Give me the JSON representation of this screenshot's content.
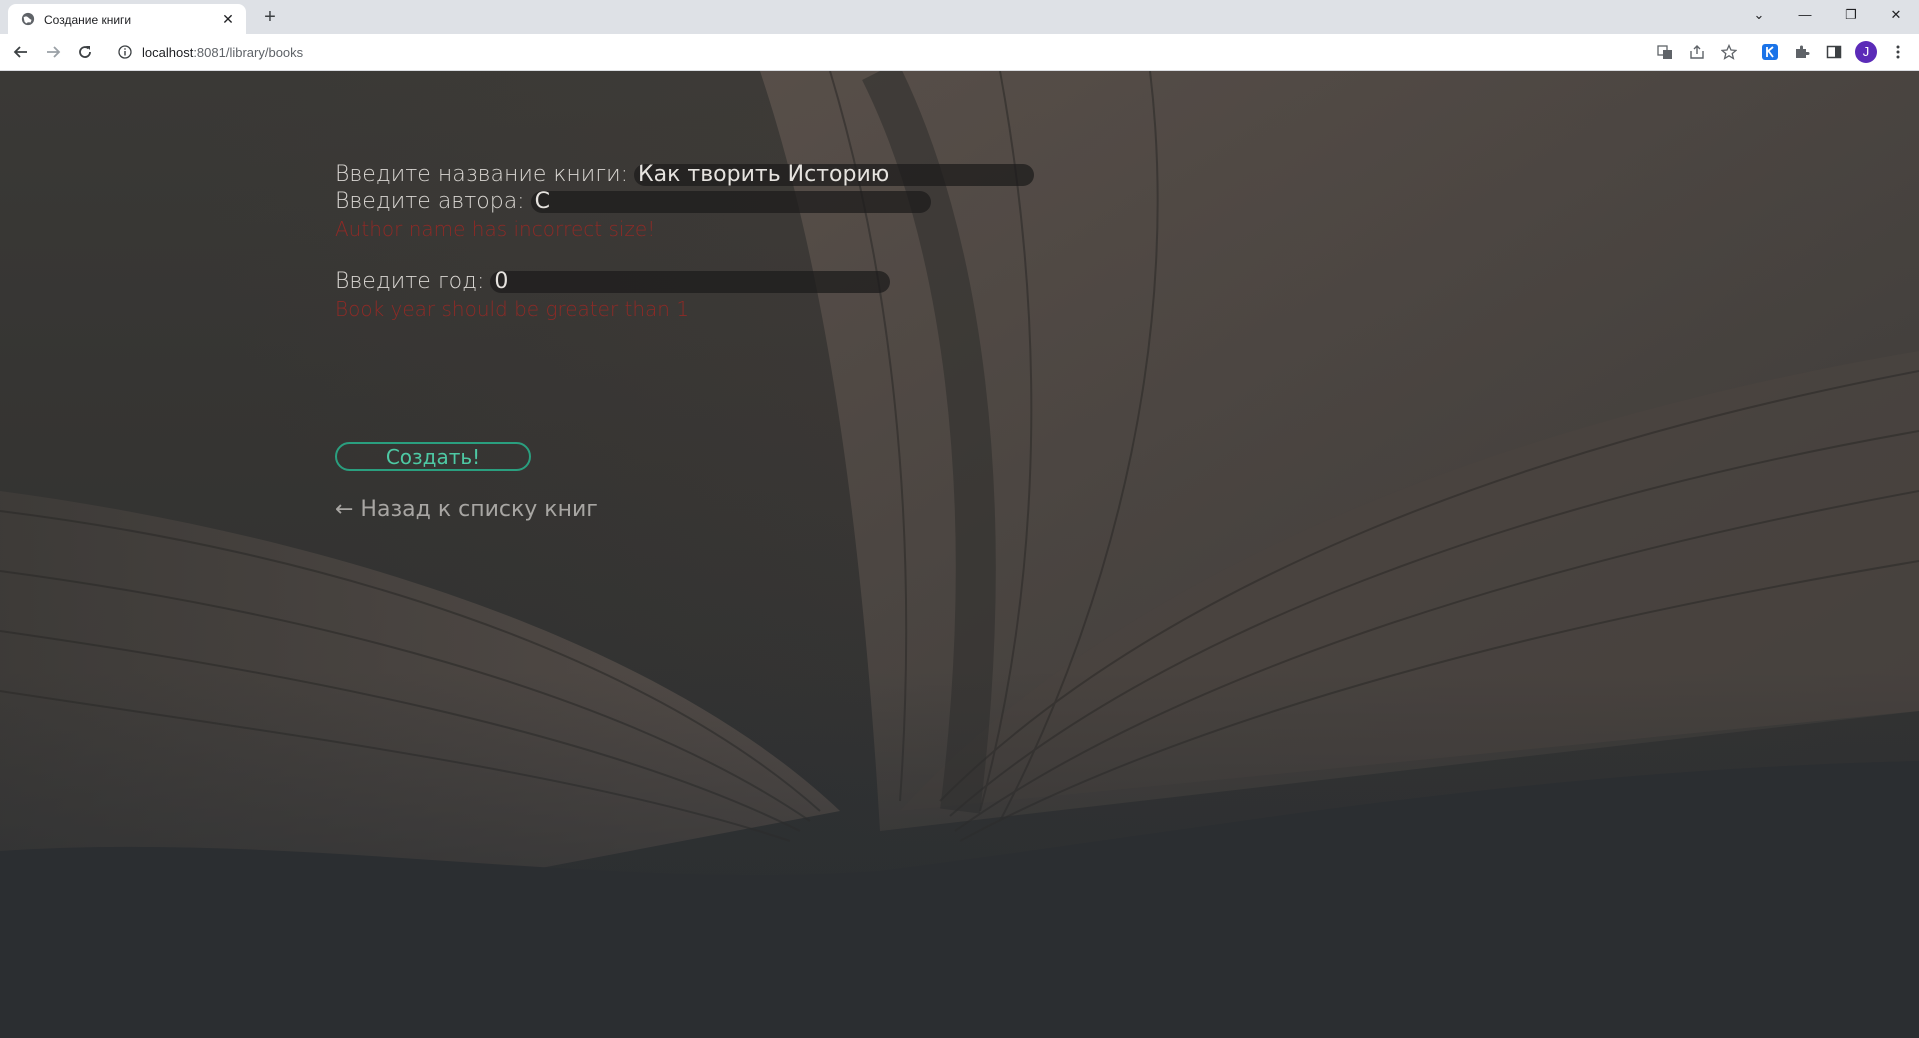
{
  "browser": {
    "tab": {
      "title": "Создание книги",
      "close_glyph": "✕"
    },
    "new_tab_glyph": "+",
    "url": {
      "host": "localhost",
      "rest": ":8081/library/books"
    },
    "profile_initial": "J",
    "window_controls": {
      "dropdown": "⌄",
      "minimize": "—",
      "restore": "❐",
      "close": "✕"
    },
    "colors": {
      "tabstrip": "#dee1e6",
      "profile": "#5b2bb8",
      "extension_k": "#1a73e8"
    }
  },
  "form": {
    "title_label": "Введите название книги:",
    "title_value": "Как творить Историю",
    "author_label": "Введите автора:",
    "author_value": "С",
    "author_error": "Author name has incorrect size!",
    "year_label": "Введите год:",
    "year_value": "0",
    "year_error": "Book year should be greater than 1",
    "submit_label": "Создать!",
    "back_link": "← Назад к списку книг"
  },
  "colors": {
    "error": "#8e2a26",
    "accent": "#2a9f7f",
    "text": "#d9d6d2"
  }
}
